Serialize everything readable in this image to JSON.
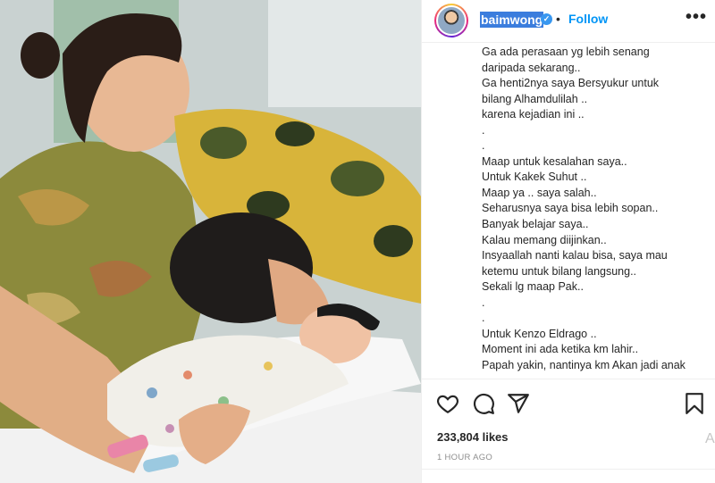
{
  "post": {
    "image_alt": "Mother holding newborn baby while father kisses the baby",
    "username": "baimwong",
    "verified": true,
    "separator": "•",
    "follow_label": "Follow",
    "more_label": "•••",
    "caption_lines": [
      "Ga ada perasaan yg lebih senang",
      "daripada sekarang..",
      "Ga henti2nya saya Bersyukur untuk",
      "bilang Alhamdulilah ..",
      "karena kejadian ini ..",
      ".",
      ".",
      "Maap untuk kesalahan saya..",
      "Untuk Kakek Suhut ..",
      "Maap ya .. saya salah..",
      "Seharusnya saya bisa lebih sopan..",
      "Banyak belajar saya..",
      "Kalau memang diijinkan..",
      "Insyaallah nanti kalau bisa, saya mau",
      "ketemu untuk bilang langsung..",
      "Sekali lg maap Pak..",
      ".",
      ".",
      "Untuk Kenzo Eldrago ..",
      "Moment ini ada ketika km lahir..",
      "Papah yakin, nantinya km Akan jadi anak"
    ],
    "likes": "233,804 likes",
    "time": "1 HOUR AGO",
    "side_glyph": "A",
    "icons": {
      "like": "heart-icon",
      "comment": "comment-icon",
      "share": "share-icon",
      "save": "bookmark-icon"
    }
  },
  "colors": {
    "link": "#0095f6",
    "text": "#262626",
    "muted": "#8e8e8e",
    "border": "#efefef",
    "selection": "#3b7ddd"
  }
}
